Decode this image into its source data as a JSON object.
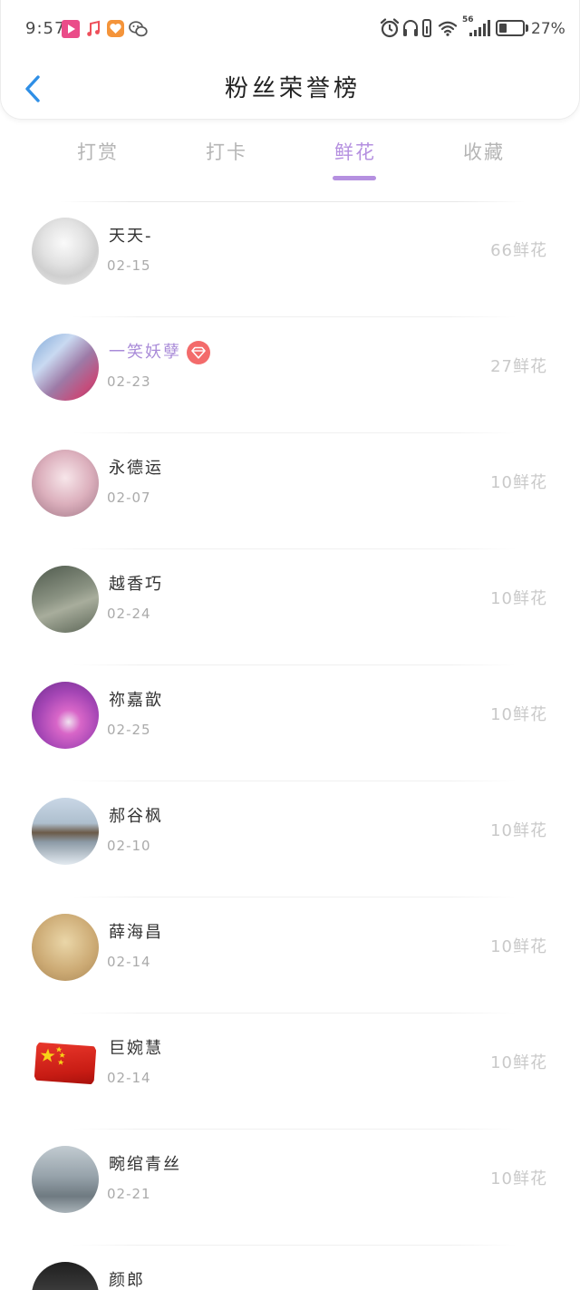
{
  "status_bar": {
    "time": "9:57",
    "network": "56",
    "battery": "27%",
    "left_icons": [
      "video-app-icon",
      "music-app-icon",
      "shopping-app-icon",
      "wechat-icon"
    ],
    "right_icons": [
      "alarm-icon",
      "headphones-icon",
      "device-icon",
      "wifi-icon",
      "signal-icon",
      "battery-icon"
    ]
  },
  "header": {
    "back_icon": "chevron-left-icon",
    "title": "粉丝荣誉榜"
  },
  "tabs": [
    {
      "label": "打赏",
      "active": false
    },
    {
      "label": "打卡",
      "active": false
    },
    {
      "label": "鲜花",
      "active": true
    },
    {
      "label": "收藏",
      "active": false
    }
  ],
  "fans": [
    {
      "name": "天天-",
      "date": "02-15",
      "count": "66鲜花"
    },
    {
      "name": "一笑妖孽",
      "date": "02-23",
      "count": "27鲜花",
      "badge": "diamond-icon"
    },
    {
      "name": "永德运",
      "date": "02-07",
      "count": "10鲜花"
    },
    {
      "name": "越香巧",
      "date": "02-24",
      "count": "10鲜花"
    },
    {
      "name": "祢嘉歆",
      "date": "02-25",
      "count": "10鲜花"
    },
    {
      "name": "郝谷枫",
      "date": "02-10",
      "count": "10鲜花"
    },
    {
      "name": "薛海昌",
      "date": "02-14",
      "count": "10鲜花"
    },
    {
      "name": "巨婉慧",
      "date": "02-14",
      "count": "10鲜花"
    },
    {
      "name": "畹绾青丝",
      "date": "02-21",
      "count": "10鲜花"
    },
    {
      "name": "颜郎"
    }
  ],
  "colors": {
    "accent": "#b590e0",
    "back_arrow": "#2f8fe6",
    "vip_name": "#a98bd8",
    "vip_badge": "#f36b6b",
    "tab_inactive": "#b5b5b5",
    "name_text": "#333333",
    "date_text": "#aaaaaa",
    "count_text": "#c9c9c9"
  }
}
